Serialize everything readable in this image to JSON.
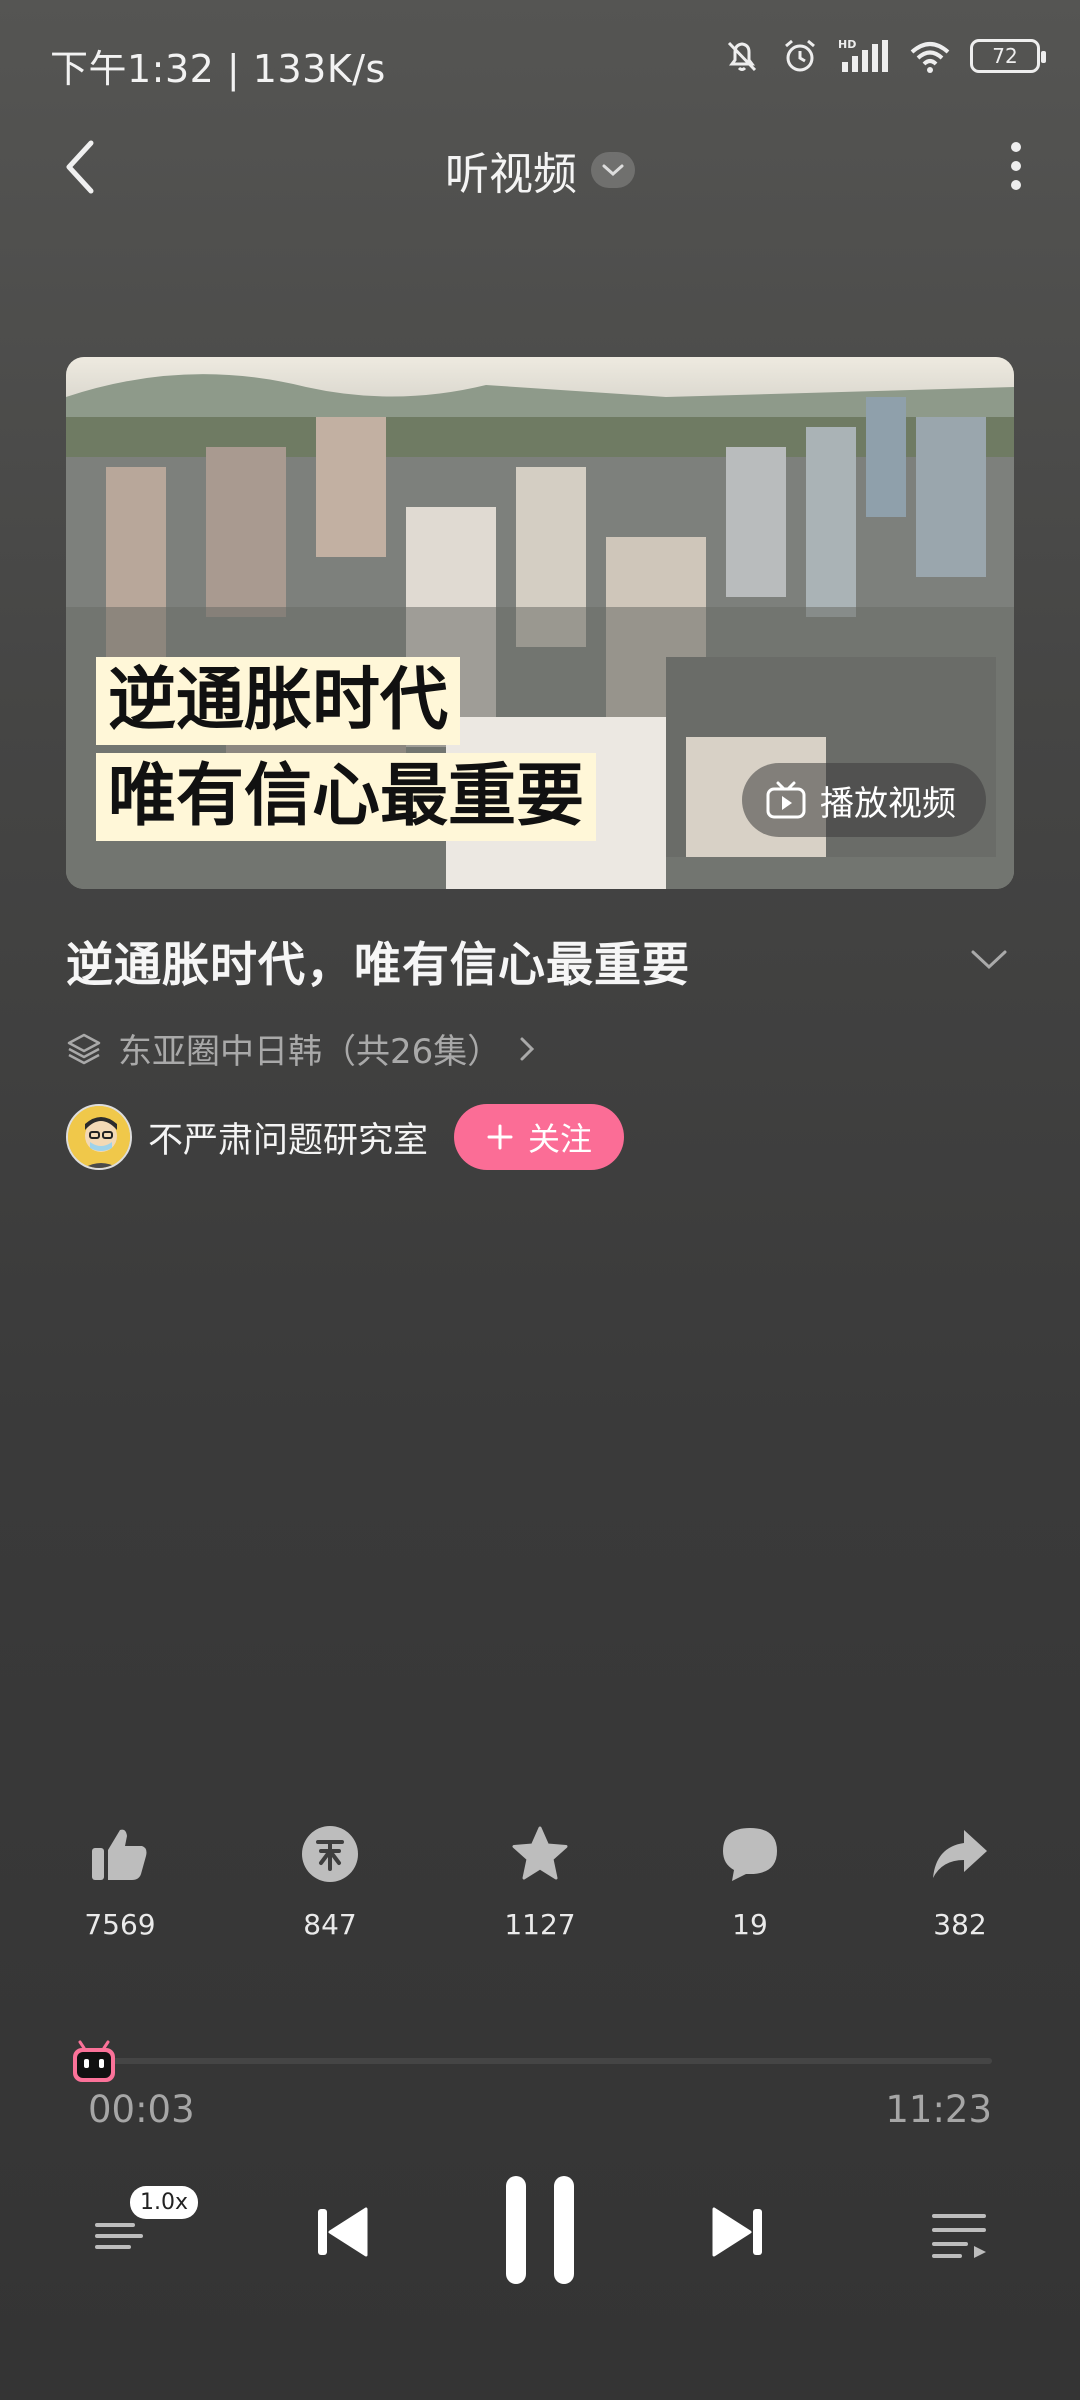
{
  "status_bar": {
    "time": "下午1:32 | 133K/s",
    "battery": "72",
    "icons": [
      "mute-bell-icon",
      "alarm-icon",
      "hd-signal-icon",
      "wifi-icon",
      "battery-icon"
    ]
  },
  "nav": {
    "title": "听视频",
    "icons": [
      "back-arrow-icon",
      "chevron-down-icon",
      "more-vertical-icon"
    ]
  },
  "video": {
    "overlay_line1": "逆通胀时代",
    "overlay_line2": "唯有信心最重要",
    "play_video_label": "播放视频"
  },
  "info": {
    "title": "逆通胀时代，唯有信心最重要",
    "series": "东亚圈中日韩（共26集）",
    "author": "不严肃问题研究室",
    "follow_label": "关注"
  },
  "actions": [
    {
      "name": "like",
      "icon": "thumbs-up-icon",
      "count": "7569"
    },
    {
      "name": "coin",
      "icon": "coin-icon",
      "count": "847"
    },
    {
      "name": "favorite",
      "icon": "star-icon",
      "count": "1127"
    },
    {
      "name": "comment",
      "icon": "comment-icon",
      "count": "19"
    },
    {
      "name": "share",
      "icon": "share-icon",
      "count": "382"
    }
  ],
  "player": {
    "current_time": "00:03",
    "total_time": "11:23",
    "progress": 0.004,
    "speed": "1.0x",
    "state": "playing"
  },
  "colors": {
    "accent": "#fb7299",
    "follow": "#fb6d96",
    "background": "#3e3e3d"
  }
}
